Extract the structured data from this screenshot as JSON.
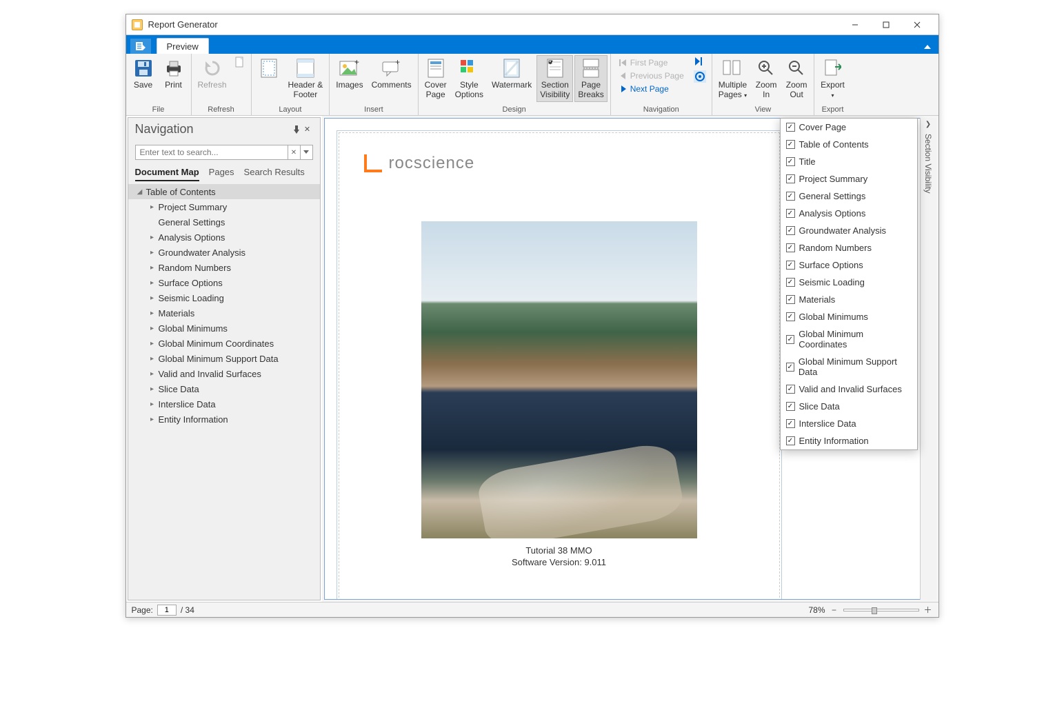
{
  "window": {
    "title": "Report Generator"
  },
  "tab": {
    "preview": "Preview"
  },
  "ribbon": {
    "file": {
      "label": "File",
      "save": "Save",
      "print": "Print"
    },
    "refresh": {
      "label": "Refresh",
      "refresh": "Refresh"
    },
    "layout": {
      "label": "Layout",
      "headerfooter": "Header &\nFooter"
    },
    "insert": {
      "label": "Insert",
      "images": "Images",
      "comments": "Comments"
    },
    "design": {
      "label": "Design",
      "cover": "Cover\nPage",
      "style": "Style\nOptions",
      "watermark": "Watermark",
      "secvis": "Section\nVisibility",
      "pagebreaks": "Page\nBreaks"
    },
    "navigation": {
      "label": "Navigation",
      "first": "First Page",
      "prev": "Previous Page",
      "next": "Next Page"
    },
    "view": {
      "label": "View",
      "multipages": "Multiple\nPages",
      "zoomin": "Zoom\nIn",
      "zoomout": "Zoom\nOut"
    },
    "export": {
      "label": "Export",
      "export": "Export"
    }
  },
  "navpanel": {
    "title": "Navigation",
    "search_placeholder": "Enter text to search...",
    "tabs": {
      "docmap": "Document Map",
      "pages": "Pages",
      "results": "Search Results"
    },
    "top": "Table of Contents",
    "items": [
      "Project Summary",
      "General Settings",
      "Analysis Options",
      "Groundwater Analysis",
      "Random Numbers",
      "Surface Options",
      "Seismic Loading",
      "Materials",
      "Global Minimums",
      "Global Minimum Coordinates",
      "Global Minimum Support Data",
      "Valid and Invalid Surfaces",
      "Slice Data",
      "Interslice Data",
      "Entity Information"
    ]
  },
  "cover": {
    "brand": "rocscience",
    "line1": "Tutorial 38 MMO",
    "line2": "Software Version: 9.011"
  },
  "secvis": {
    "sidebar": "Section Visibility",
    "items": [
      "Cover Page",
      "Table of Contents",
      "Title",
      "Project Summary",
      "General Settings",
      "Analysis Options",
      "Groundwater Analysis",
      "Random Numbers",
      "Surface Options",
      "Seismic Loading",
      "Materials",
      "Global Minimums",
      "Global Minimum Coordinates",
      "Global Minimum Support Data",
      "Valid and Invalid Surfaces",
      "Slice Data",
      "Interslice Data",
      "Entity Information"
    ]
  },
  "status": {
    "page_label": "Page:",
    "page_current": "1",
    "page_total": "/ 34",
    "zoom": "78%"
  }
}
